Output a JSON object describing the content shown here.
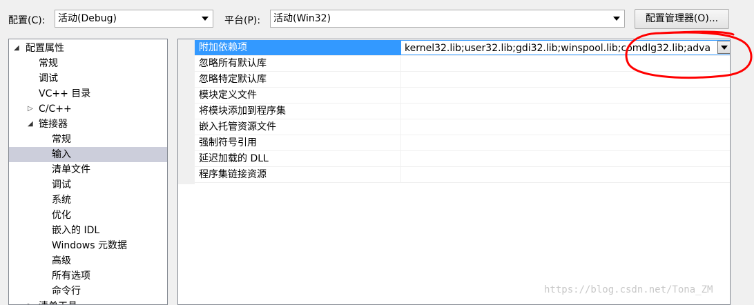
{
  "toolbar": {
    "config_label": "配置(C):",
    "config_value": "活动(Debug)",
    "platform_label": "平台(P):",
    "platform_value": "活动(Win32)",
    "manager_button": "配置管理器(O)..."
  },
  "tree": {
    "root_expander": "◢",
    "root": "配置属性",
    "general": "常规",
    "debugging": "调试",
    "vc_dirs": "VC++ 目录",
    "cpp_expander": "▷",
    "cpp": "C/C++",
    "linker_expander": "◢",
    "linker": "链接器",
    "linker_general": "常规",
    "linker_input": "输入",
    "linker_manifest": "清单文件",
    "linker_debug": "调试",
    "linker_system": "系统",
    "linker_optimize": "优化",
    "linker_idl": "嵌入的 IDL",
    "linker_winmd": "Windows 元数据",
    "linker_advanced": "高级",
    "linker_alloptions": "所有选项",
    "linker_cmdline": "命令行",
    "manifest_tool_expander": "▷",
    "manifest_tool": "清单工具"
  },
  "grid": {
    "rows": [
      {
        "name": "附加依赖项",
        "value": "kernel32.lib;user32.lib;gdi32.lib;winspool.lib;comdlg32.lib;adva"
      },
      {
        "name": "忽略所有默认库",
        "value": ""
      },
      {
        "name": "忽略特定默认库",
        "value": ""
      },
      {
        "name": "模块定义文件",
        "value": ""
      },
      {
        "name": "将模块添加到程序集",
        "value": ""
      },
      {
        "name": "嵌入托管资源文件",
        "value": ""
      },
      {
        "name": "强制符号引用",
        "value": ""
      },
      {
        "name": "延迟加载的 DLL",
        "value": ""
      },
      {
        "name": "程序集链接资源",
        "value": ""
      }
    ]
  },
  "annotation_color": "#ff0000",
  "watermark": "https://blog.csdn.net/Tona_ZM"
}
